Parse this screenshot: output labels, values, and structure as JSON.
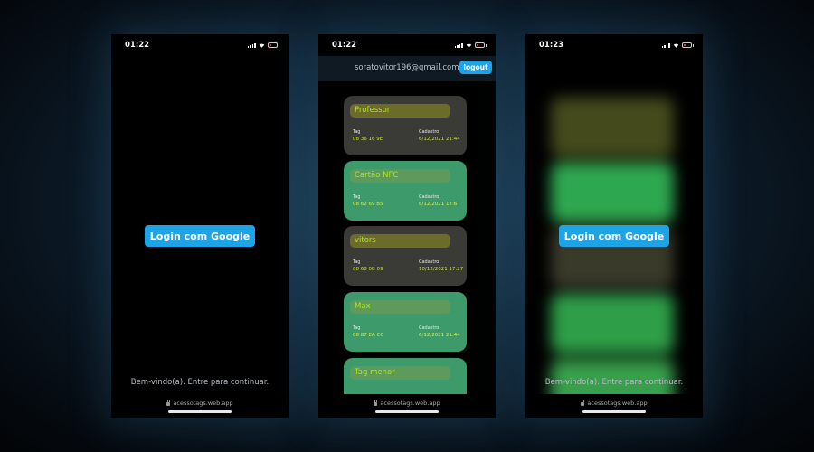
{
  "status_times": [
    "01:22",
    "01:22",
    "01:23"
  ],
  "login_button_label": "Login com Google",
  "welcome_text": "Bem-vindo(a). Entre para continuar.",
  "url": "acessotags.web.app",
  "header": {
    "email": "soratovitor196@gmail.com",
    "logout_label": "logout"
  },
  "tag_label": "Tag",
  "cadastro_label": "Cadastro",
  "cards": [
    {
      "name": "Professor",
      "tag": "08 36 16 9E",
      "cadastro": "6/12/2021 21:44",
      "color": "#3a3a37"
    },
    {
      "name": "Cartão NFC",
      "tag": "08 62 69 B5",
      "cadastro": "6/12/2021 17:6",
      "color": "#3d9a6a"
    },
    {
      "name": "vitors",
      "tag": "08 68 0B 09",
      "cadastro": "10/12/2021 17:27",
      "color": "#3a3a37"
    },
    {
      "name": "Max",
      "tag": "08 87 EA CC",
      "cadastro": "6/12/2021 21:44",
      "color": "#3d9a6a"
    },
    {
      "name": "Tag menor",
      "tag": "",
      "cadastro": "",
      "color": "#3d9a6a"
    }
  ],
  "icons": [
    "signal-icon",
    "wifi-icon",
    "battery-icon",
    "lock-icon"
  ],
  "accent_color": "#1ea3e6"
}
